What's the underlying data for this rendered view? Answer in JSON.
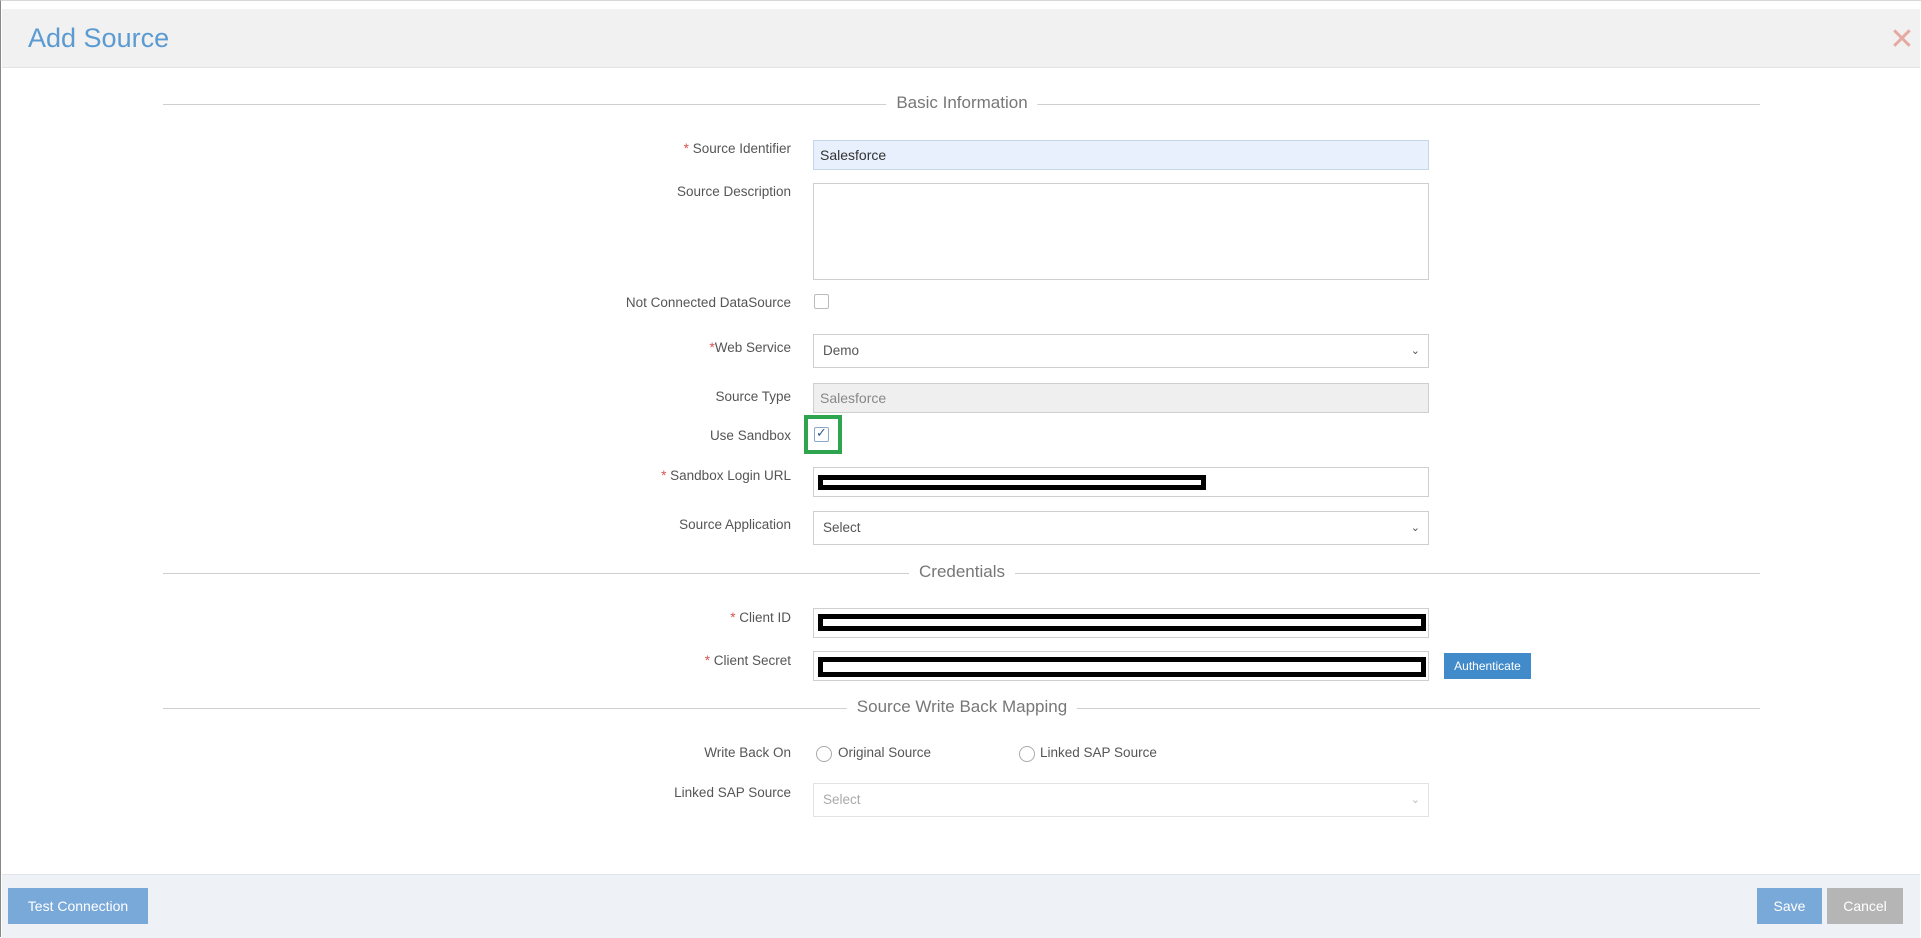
{
  "header": {
    "title": "Add Source",
    "close_label": "✕"
  },
  "sections": {
    "basic": "Basic Information",
    "credentials": "Credentials",
    "write_back": "Source Write Back Mapping"
  },
  "fields": {
    "source_identifier": {
      "label": "Source Identifier",
      "value": "Salesforce"
    },
    "source_description": {
      "label": "Source Description",
      "value": ""
    },
    "not_connected": {
      "label": "Not Connected DataSource",
      "checked": false
    },
    "web_service": {
      "label": "Web Service",
      "value": "Demo"
    },
    "source_type": {
      "label": "Source Type",
      "value": "Salesforce"
    },
    "use_sandbox": {
      "label": "Use Sandbox",
      "checked": true
    },
    "sandbox_login_url": {
      "label": "Sandbox Login URL"
    },
    "source_application": {
      "label": "Source Application",
      "value": "Select"
    },
    "client_id": {
      "label": "Client ID"
    },
    "client_secret": {
      "label": "Client Secret"
    },
    "write_back_on": {
      "label": "Write Back On",
      "options": [
        "Original Source",
        "Linked SAP Source"
      ]
    },
    "linked_sap_source": {
      "label": "Linked SAP Source",
      "value": "Select"
    }
  },
  "buttons": {
    "authenticate": "Authenticate",
    "test_connection": "Test Connection",
    "save": "Save",
    "cancel": "Cancel"
  },
  "colors": {
    "title": "#5b9bd1",
    "primary_button": "#428bca",
    "highlight": "#2ea44f",
    "required": "#d9534f"
  }
}
